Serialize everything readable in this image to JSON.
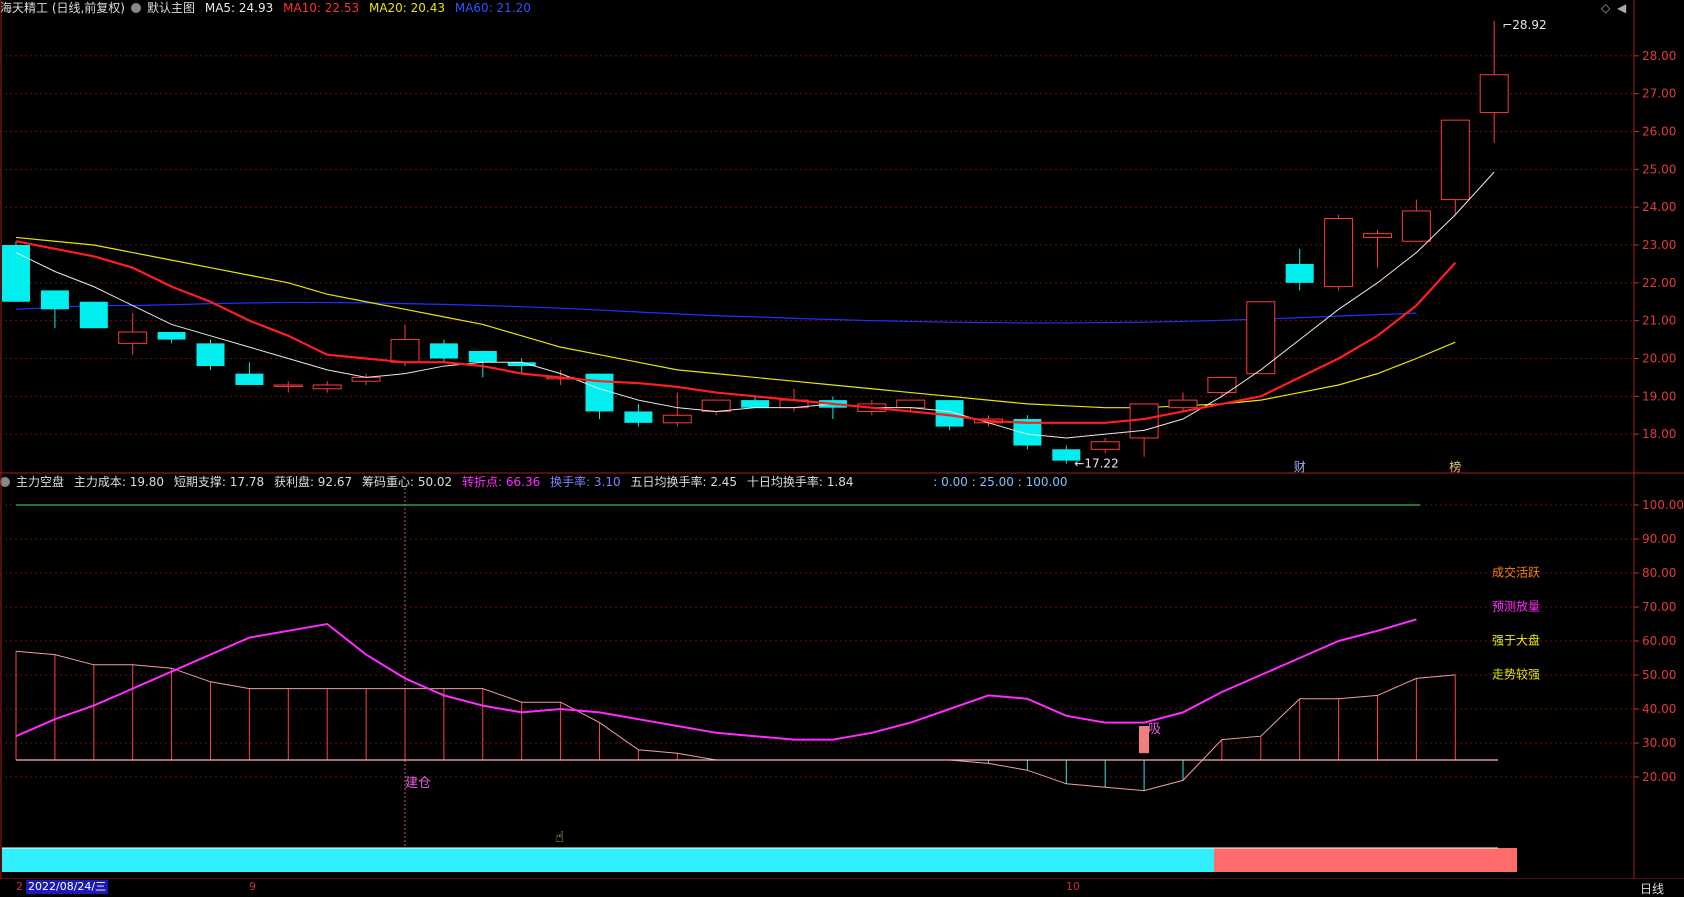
{
  "main_header": {
    "stock": "海天精工 (日线,前复权)",
    "template": "默认主图",
    "ma5": "MA5: 24.93",
    "ma10": "MA10: 22.53",
    "ma20": "MA20: 20.43",
    "ma60": "MA60: 21.20"
  },
  "sub_header": {
    "name": "主力空盘",
    "cost": "主力成本: 19.80",
    "support": "短期支撑: 17.78",
    "profit": "获利盘: 92.67",
    "center": "筹码重心: 50.02",
    "turn": "转折点: 66.36",
    "turnover": "换手率: 3.10",
    "avg5": "五日均换手率: 2.45",
    "avg10": "十日均换手率: 1.84",
    "levels": ": 0.00 : 25.00 : 100.00"
  },
  "colors": {
    "up": "#ff3a3a",
    "down": "#00f0f0",
    "ma5": "#e8e8e8",
    "ma10": "#ff1e1e",
    "ma20": "#e6e600",
    "ma60": "#2030ff",
    "magenta": "#ff2bff",
    "pink": "#f0a0a0"
  },
  "bottom": {
    "date": "2022/08/24/三",
    "tick9": "9",
    "tick10": "10",
    "tick_left": "2",
    "period": "日线"
  },
  "chart_data": [
    {
      "type": "candlestick",
      "title": "",
      "ylim": [
        17.0,
        29.0
      ],
      "y_ticks": [
        18,
        19,
        20,
        21,
        22,
        23,
        24,
        25,
        26,
        27,
        28
      ],
      "y_tick_labels": [
        "18.00",
        "19.00",
        "20.00",
        "21.00",
        "22.00",
        "23.00",
        "24.00",
        "25.00",
        "26.00",
        "27.00",
        "28.00"
      ],
      "candles": [
        {
          "o": 23.0,
          "h": 23.1,
          "l": 21.5,
          "c": 21.5
        },
        {
          "o": 21.8,
          "h": 21.8,
          "l": 20.8,
          "c": 21.3
        },
        {
          "o": 21.5,
          "h": 21.5,
          "l": 20.8,
          "c": 20.8
        },
        {
          "o": 20.4,
          "h": 21.2,
          "l": 20.1,
          "c": 20.7
        },
        {
          "o": 20.7,
          "h": 20.7,
          "l": 20.4,
          "c": 20.5
        },
        {
          "o": 20.4,
          "h": 20.5,
          "l": 19.7,
          "c": 19.8
        },
        {
          "o": 19.6,
          "h": 19.9,
          "l": 19.3,
          "c": 19.3
        },
        {
          "o": 19.3,
          "h": 19.4,
          "l": 19.1,
          "c": 19.3
        },
        {
          "o": 19.2,
          "h": 19.4,
          "l": 19.1,
          "c": 19.3
        },
        {
          "o": 19.4,
          "h": 19.6,
          "l": 19.3,
          "c": 19.5
        },
        {
          "o": 19.9,
          "h": 20.9,
          "l": 19.8,
          "c": 20.5
        },
        {
          "o": 20.4,
          "h": 20.5,
          "l": 19.9,
          "c": 20.0
        },
        {
          "o": 20.2,
          "h": 20.2,
          "l": 19.5,
          "c": 19.9
        },
        {
          "o": 19.9,
          "h": 20.0,
          "l": 19.6,
          "c": 19.8
        },
        {
          "o": 19.5,
          "h": 19.7,
          "l": 19.3,
          "c": 19.5
        },
        {
          "o": 19.6,
          "h": 19.6,
          "l": 18.4,
          "c": 18.6
        },
        {
          "o": 18.6,
          "h": 18.8,
          "l": 18.2,
          "c": 18.3
        },
        {
          "o": 18.3,
          "h": 19.1,
          "l": 18.2,
          "c": 18.5
        },
        {
          "o": 18.6,
          "h": 18.9,
          "l": 18.5,
          "c": 18.9
        },
        {
          "o": 18.9,
          "h": 19.0,
          "l": 18.7,
          "c": 18.7
        },
        {
          "o": 18.7,
          "h": 19.2,
          "l": 18.6,
          "c": 18.9
        },
        {
          "o": 18.9,
          "h": 19.0,
          "l": 18.4,
          "c": 18.7
        },
        {
          "o": 18.6,
          "h": 18.9,
          "l": 18.5,
          "c": 18.8
        },
        {
          "o": 18.7,
          "h": 18.9,
          "l": 18.6,
          "c": 18.9
        },
        {
          "o": 18.9,
          "h": 18.9,
          "l": 18.1,
          "c": 18.2
        },
        {
          "o": 18.3,
          "h": 18.5,
          "l": 18.2,
          "c": 18.4
        },
        {
          "o": 18.4,
          "h": 18.5,
          "l": 17.6,
          "c": 17.7
        },
        {
          "o": 17.6,
          "h": 17.7,
          "l": 17.22,
          "c": 17.3
        },
        {
          "o": 17.6,
          "h": 17.9,
          "l": 17.5,
          "c": 17.8
        },
        {
          "o": 17.9,
          "h": 18.8,
          "l": 17.4,
          "c": 18.8
        },
        {
          "o": 18.7,
          "h": 19.1,
          "l": 18.6,
          "c": 18.9
        },
        {
          "o": 19.1,
          "h": 19.5,
          "l": 19.0,
          "c": 19.5
        },
        {
          "o": 19.6,
          "h": 21.5,
          "l": 19.6,
          "c": 21.5
        },
        {
          "o": 22.5,
          "h": 22.9,
          "l": 21.8,
          "c": 22.0
        },
        {
          "o": 21.9,
          "h": 23.8,
          "l": 21.8,
          "c": 23.7
        },
        {
          "o": 23.2,
          "h": 23.4,
          "l": 22.4,
          "c": 23.3
        },
        {
          "o": 23.1,
          "h": 24.2,
          "l": 23.1,
          "c": 23.9
        },
        {
          "o": 24.2,
          "h": 26.3,
          "l": 23.8,
          "c": 26.3
        },
        {
          "o": 26.5,
          "h": 28.92,
          "l": 25.7,
          "c": 27.5
        }
      ],
      "ma5": [
        22.8,
        22.3,
        21.9,
        21.4,
        20.9,
        20.6,
        20.3,
        20.0,
        19.7,
        19.5,
        19.6,
        19.8,
        19.9,
        19.9,
        19.6,
        19.2,
        18.9,
        18.7,
        18.6,
        18.7,
        18.7,
        18.8,
        18.7,
        18.7,
        18.6,
        18.3,
        18.0,
        17.9,
        18.0,
        18.1,
        18.4,
        19.0,
        19.7,
        20.5,
        21.3,
        22.0,
        22.8,
        23.8,
        24.93
      ],
      "ma10": [
        23.1,
        22.9,
        22.7,
        22.4,
        21.9,
        21.5,
        21.0,
        20.6,
        20.1,
        20.0,
        19.9,
        19.9,
        19.8,
        19.6,
        19.5,
        19.4,
        19.35,
        19.25,
        19.1,
        19.0,
        18.9,
        18.8,
        18.7,
        18.6,
        18.5,
        18.35,
        18.3,
        18.3,
        18.3,
        18.4,
        18.6,
        18.8,
        19.0,
        19.5,
        20.0,
        20.6,
        21.4,
        22.53
      ],
      "ma20": [
        23.2,
        23.1,
        23.0,
        22.8,
        22.6,
        22.4,
        22.2,
        22.0,
        21.7,
        21.5,
        21.3,
        21.1,
        20.9,
        20.6,
        20.3,
        20.1,
        19.9,
        19.7,
        19.6,
        19.5,
        19.4,
        19.3,
        19.2,
        19.1,
        19.0,
        18.9,
        18.8,
        18.75,
        18.7,
        18.7,
        18.75,
        18.8,
        18.9,
        19.1,
        19.3,
        19.6,
        20.0,
        20.43
      ],
      "ma60": [
        21.3,
        21.35,
        21.4,
        21.4,
        21.42,
        21.45,
        21.47,
        21.48,
        21.48,
        21.47,
        21.45,
        21.43,
        21.4,
        21.37,
        21.33,
        21.28,
        21.23,
        21.18,
        21.13,
        21.1,
        21.06,
        21.03,
        21.0,
        20.98,
        20.96,
        20.95,
        20.94,
        20.94,
        20.95,
        20.96,
        20.98,
        21.01,
        21.04,
        21.08,
        21.12,
        21.16,
        21.2
      ],
      "annotations": [
        {
          "text": "28.92",
          "candle": 38,
          "price": 28.92
        },
        {
          "text": "17.22",
          "candle": 27,
          "price": 17.22
        },
        {
          "text": "财",
          "candle": 33
        },
        {
          "text": "榜",
          "candle": 37
        }
      ]
    },
    {
      "type": "line",
      "title": "",
      "ylim": [
        0,
        105
      ],
      "y_ticks": [
        20,
        30,
        40,
        50,
        60,
        70,
        80,
        90,
        100
      ],
      "y_tick_labels": [
        "20.00",
        "30.00",
        "40.00",
        "50.00",
        "60.00",
        "70.00",
        "80.00",
        "90.00",
        "100.00"
      ],
      "base": 25,
      "top_line": 100,
      "magenta": [
        32,
        37,
        41,
        46,
        51,
        56,
        61,
        63,
        65,
        56,
        49,
        44,
        41,
        39,
        40,
        39,
        37,
        35,
        33,
        32,
        31,
        31,
        33,
        36,
        40,
        44,
        43,
        38,
        36,
        36,
        39,
        45,
        50,
        55,
        60,
        63,
        66.36
      ],
      "pink": [
        57,
        56,
        53,
        53,
        52,
        48,
        46,
        46,
        46,
        46,
        46,
        46,
        46,
        42,
        42,
        36,
        28,
        27,
        25,
        25,
        25,
        25,
        25,
        25,
        25,
        24,
        22,
        18,
        17,
        16,
        19,
        31,
        32,
        43,
        43,
        44,
        49,
        50.02
      ],
      "labels": [
        {
          "text": "建仓",
          "color": "#e060e0"
        },
        {
          "text": "吸",
          "color": "#e060e0"
        },
        {
          "text": "成交活跃",
          "color": "#ff8000"
        },
        {
          "text": "预测放量",
          "color": "#ff2bff"
        },
        {
          "text": "强于大盘",
          "color": "#f0f000"
        },
        {
          "text": "走势较强",
          "color": "#e6e600"
        }
      ],
      "bar_split": 0.8
    }
  ]
}
